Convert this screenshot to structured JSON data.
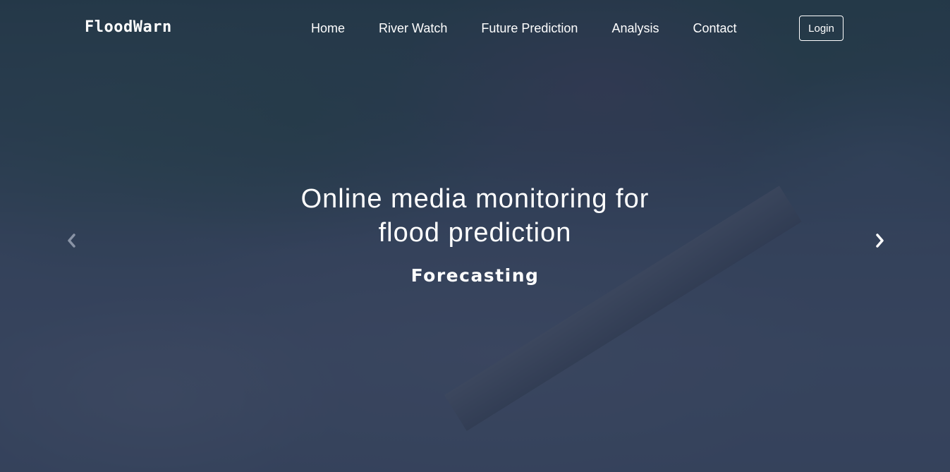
{
  "navbar": {
    "brand": "FloodWarn",
    "links": [
      {
        "label": "Home"
      },
      {
        "label": "River Watch"
      },
      {
        "label": "Future Prediction"
      },
      {
        "label": "Analysis"
      },
      {
        "label": "Contact"
      }
    ],
    "login_label": "Login"
  },
  "hero": {
    "headline": "Online media monitoring for flood prediction",
    "subheading": "Forecasting",
    "controls": {
      "prev_icon": "chevron-left-icon",
      "next_icon": "chevron-right-icon"
    }
  },
  "colors": {
    "overlay": "#1e2c4b",
    "text": "#ffffff"
  }
}
